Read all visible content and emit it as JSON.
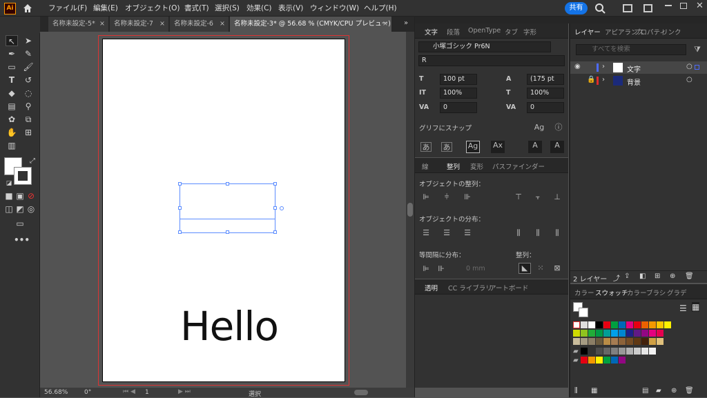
{
  "app": {
    "logo": "Ai",
    "share_label": "共有"
  },
  "menu": [
    "ファイル(F)",
    "編集(E)",
    "オブジェクト(O)",
    "書式(T)",
    "選択(S)",
    "効果(C)",
    "表示(V)",
    "ウィンドウ(W)",
    "ヘルプ(H)"
  ],
  "tabs": [
    {
      "label": "名称未設定-5*",
      "close": "×"
    },
    {
      "label": "名称未設定-7",
      "close": "×"
    },
    {
      "label": "名称未設定-6",
      "close": "×"
    },
    {
      "label": "名称未設定-3* @ 56.68 % (CMYK/CPU プレビュー)",
      "close": "×"
    }
  ],
  "artboard": {
    "text": "Hello"
  },
  "status": {
    "zoom": "56.68%",
    "angle": "0°",
    "page": "1",
    "mode": "選択"
  },
  "char_panel": {
    "tabs": [
      "文字",
      "段落",
      "OpenType",
      "タブ",
      "字形"
    ],
    "font_family": "小塚ゴシック Pr6N",
    "font_style": "R",
    "size": "100 pt",
    "leading": "(175 pt",
    "v_scale": "100%",
    "h_scale": "100%",
    "kerning": "0",
    "tracking": "0",
    "snap_label": "グリフにスナップ"
  },
  "align_panel": {
    "tabs": [
      "線",
      "整列",
      "変形",
      "パスファインダー"
    ],
    "align_objects": "オブジェクトの整列：",
    "distribute_objects": "オブジェクトの分布：",
    "distribute_spacing": "等間隔に分布：",
    "align_to": "整列：",
    "spacing_value": "0 mm"
  },
  "bottom_panel": {
    "tabs": [
      "透明",
      "CC ライブラリ",
      "アートボード"
    ]
  },
  "layers_panel": {
    "tabs": [
      "レイヤー",
      "アピアランス",
      "プロパティ",
      "リンク"
    ],
    "search_placeholder": "すべてを検索",
    "layers": [
      {
        "name": "文字",
        "color": "#4d6bff"
      },
      {
        "name": "背景",
        "color": "#e02b2b"
      }
    ],
    "count_label": "2 レイヤー"
  },
  "swatches_panel": {
    "tabs": [
      "カラー",
      "スウォッチ",
      "カラー",
      "ブラシ",
      "グラデ"
    ]
  },
  "colors": {
    "accent": "#1473e6",
    "row1": [
      "#ffffff",
      "#000000",
      "#e60012",
      "#00a040",
      "#0068b7",
      "#e4007f",
      "#e60012",
      "#eb6100",
      "#f39800",
      "#fcc800",
      "#fff100"
    ],
    "row2": [
      "#cfdb00",
      "#8fc31f",
      "#22ac38",
      "#009944",
      "#009e96",
      "#00a0e9",
      "#0086d1",
      "#1d2088",
      "#601986",
      "#920783",
      "#e4007f",
      "#e5004f"
    ],
    "row3": [
      "#c9bc9c",
      "#a59b83",
      "#8b7e66",
      "#6a5a3e",
      "#b98c46",
      "#a67c52",
      "#8c6239",
      "#754c24",
      "#603813",
      "#42210b",
      "#d0a044",
      "#e0c07c"
    ],
    "row4": [
      "#000000",
      "#333333",
      "#4d4d4d",
      "#666666",
      "#808080",
      "#999999",
      "#b3b3b3",
      "#cccccc",
      "#e6e6e6",
      "#f2f2f2"
    ],
    "row5": [
      "#e60012",
      "#f39800",
      "#fff100",
      "#00a040",
      "#0068b7",
      "#920783"
    ]
  }
}
